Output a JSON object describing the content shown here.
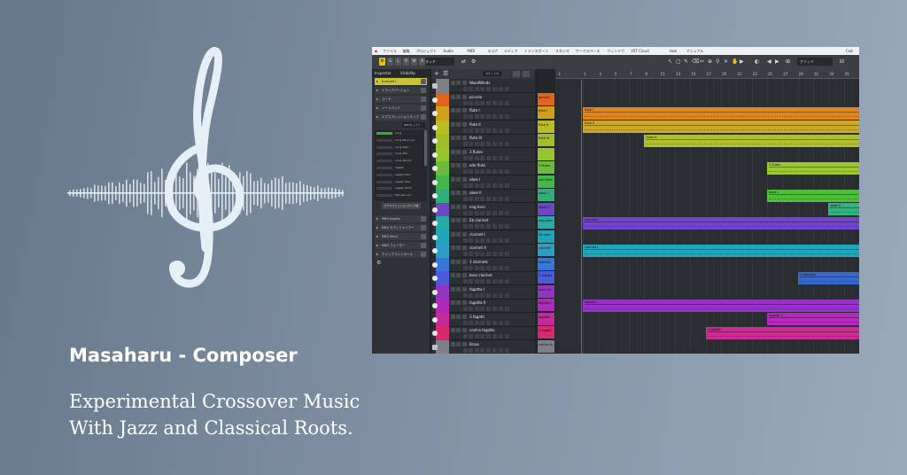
{
  "page": {
    "title": "Masaharu - Composer",
    "tagline_line1": "Experimental Crossover Music",
    "tagline_line2": "With Jazz and Classical Roots."
  },
  "logo": {
    "icon": "treble-clef-soundwave-icon",
    "color": "#e6eef6"
  },
  "screenshot": {
    "app_title": "Cub",
    "menu": [
      "ファイル",
      "編集",
      "プロジェクト",
      "Audio",
      "MIDI",
      "スコア",
      "メディア",
      "トランスポート",
      "スタジオ",
      "ワークスペース",
      "ウィンドウ",
      "VST Cloud",
      "Hub",
      "マニュアル"
    ],
    "toolbar": {
      "buttons": [
        "M",
        "S",
        "L",
        "R",
        "W",
        "A"
      ],
      "mode_select": "タッチ",
      "snap_select": "グリッド"
    },
    "inspector": {
      "tabs": [
        "Inspector",
        "Visibility"
      ],
      "track_name": "trumpet I",
      "sections": [
        "トラックバージョン",
        "コード",
        "ノートパッド",
        "エクスプレッションマップ"
      ],
      "expression_select": "HEDカップ",
      "articulations": [
        "Long",
        "Long Marc Lon",
        "Long Marc",
        "Long Stac",
        "Long Stacdo",
        "Legato",
        "Legato Marc",
        "Legato Stac",
        "Legato Stcto",
        "Marcato Lon"
      ],
      "expression_button": "エクスプレッションマップ設",
      "lower_sections": [
        "MIDI Inserts",
        "MIDI モディファイアー",
        "MIDI Send",
        "MIDI フェーダー",
        "クイックコントロール"
      ]
    },
    "tracklist": {
      "zoom_label": "1/4 ♩ 1/4",
      "tracks": [
        {
          "name": "WoodWinds",
          "color": "#7d8186",
          "folder": true
        },
        {
          "name": "piccolo",
          "color": "#e0641c"
        },
        {
          "name": "flute I",
          "color": "#d1a01a"
        },
        {
          "name": "flute II",
          "color": "#b9bd22"
        },
        {
          "name": "flute III",
          "color": "#a2bd2c"
        },
        {
          "name": "3 flutes",
          "color": "#96c42c"
        },
        {
          "name": "alto flute",
          "color": "#6cbb3c"
        },
        {
          "name": "oboe I",
          "color": "#42b84c"
        },
        {
          "name": "oboe II",
          "color": "#2fae7a"
        },
        {
          "name": "eng.horn",
          "color": "#6c48c4"
        },
        {
          "name": "Eb clarinet",
          "color": "#29a9a3"
        },
        {
          "name": "clarinet I",
          "color": "#1ea5b8"
        },
        {
          "name": "clarinet II",
          "color": "#2f9cc4"
        },
        {
          "name": "3 clarinets",
          "color": "#3777d8"
        },
        {
          "name": "bass clarinet",
          "color": "#4a5ad8"
        },
        {
          "name": "fagotto I",
          "color": "#9434c2"
        },
        {
          "name": "fagotto II",
          "color": "#b02ab8"
        },
        {
          "name": "3 fagotti",
          "color": "#c42a9c"
        },
        {
          "name": "contra fagotto",
          "color": "#d62a6c"
        },
        {
          "name": "Brass",
          "color": "#7d8186",
          "folder": true
        }
      ]
    },
    "clip_names": [
      "piccolo",
      "flute I",
      "flute II",
      "flute III",
      "",
      "3 flutes",
      "alto flute",
      "oboe I",
      "oboe II",
      "eng.horn",
      "Eb clari",
      "clarinet",
      "clarinet",
      "3 clarine",
      "bass cla",
      "fagotto I",
      "fagotto",
      "3 fagott",
      "contra fa"
    ],
    "ruler": [
      "1",
      "3",
      "5",
      "7",
      "9",
      "11",
      "13",
      "15",
      "17",
      "19",
      "21",
      "23",
      "25",
      "27",
      "29",
      "31",
      "33",
      "35",
      "37"
    ],
    "ruler_start": "-1",
    "parts": [
      {
        "label": "flute I",
        "lane": 2,
        "start": 1,
        "end": 37,
        "color": "#e0851e"
      },
      {
        "label": "flute II",
        "lane": 3,
        "start": 1,
        "end": 37,
        "color": "#c9a82a"
      },
      {
        "label": "flute III",
        "lane": 4,
        "start": 9,
        "end": 37,
        "color": "#b1c02e"
      },
      {
        "label": "3 flutes",
        "lane": 6,
        "start": 25,
        "end": 37,
        "color": "#9cc82e"
      },
      {
        "label": "oboe I",
        "lane": 8,
        "start": 25,
        "end": 37,
        "color": "#4fbd3e"
      },
      {
        "label": "oboe II",
        "lane": 9,
        "start": 33,
        "end": 37,
        "color": "#30b37c"
      },
      {
        "label": "eng.horn",
        "lane": 10,
        "start": 1,
        "end": 37,
        "color": "#7244cc"
      },
      {
        "label": "clarinet I",
        "lane": 12,
        "start": 1,
        "end": 37,
        "color": "#22a5bb"
      },
      {
        "label": "3 clarinets",
        "lane": 14,
        "start": 29,
        "end": 37,
        "color": "#3669cf"
      },
      {
        "label": "fagotto I",
        "lane": 16,
        "start": 1,
        "end": 37,
        "color": "#9634c8"
      },
      {
        "label": "fagotto II",
        "lane": 17,
        "start": 25,
        "end": 37,
        "color": "#b828bf"
      },
      {
        "label": "3 fagotti",
        "lane": 18,
        "start": 17,
        "end": 37,
        "color": "#cd2a94"
      }
    ]
  }
}
